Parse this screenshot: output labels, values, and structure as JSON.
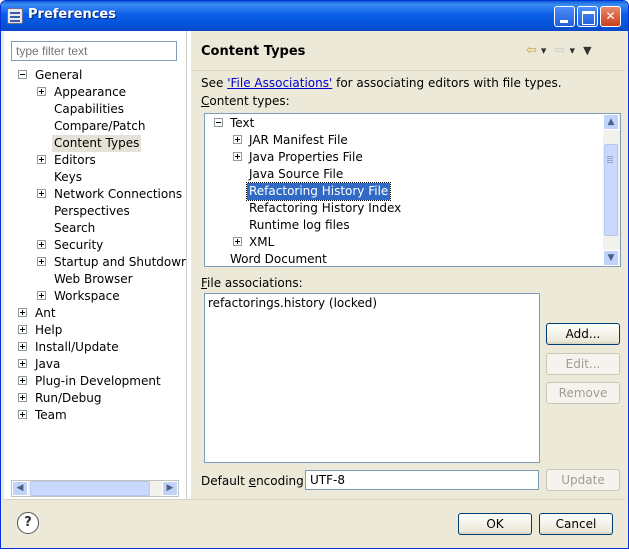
{
  "window": {
    "title": "Preferences"
  },
  "filter": {
    "placeholder": "type filter text"
  },
  "nav_tree": [
    {
      "label": "General",
      "expander": "minus"
    },
    {
      "label": "Appearance",
      "expander": "plus"
    },
    {
      "label": "Capabilities",
      "expander": ""
    },
    {
      "label": "Compare/Patch",
      "expander": ""
    },
    {
      "label": "Content Types",
      "expander": "",
      "selected": true
    },
    {
      "label": "Editors",
      "expander": "plus"
    },
    {
      "label": "Keys",
      "expander": ""
    },
    {
      "label": "Network Connections",
      "expander": "plus"
    },
    {
      "label": "Perspectives",
      "expander": ""
    },
    {
      "label": "Search",
      "expander": ""
    },
    {
      "label": "Security",
      "expander": "plus"
    },
    {
      "label": "Startup and Shutdowr",
      "expander": "plus"
    },
    {
      "label": "Web Browser",
      "expander": ""
    },
    {
      "label": "Workspace",
      "expander": "plus"
    },
    {
      "label": "Ant",
      "expander": "plus"
    },
    {
      "label": "Help",
      "expander": "plus"
    },
    {
      "label": "Install/Update",
      "expander": "plus"
    },
    {
      "label": "Java",
      "expander": "plus"
    },
    {
      "label": "Plug-in Development",
      "expander": "plus"
    },
    {
      "label": "Run/Debug",
      "expander": "plus"
    },
    {
      "label": "Team",
      "expander": "plus"
    }
  ],
  "page": {
    "title": "Content Types",
    "see_prefix": "See ",
    "see_link": "'File Associations'",
    "see_suffix": " for associating editors with file types.",
    "content_types_label_u": "C",
    "content_types_label_rest": "ontent types:",
    "file_assoc_label_u": "F",
    "file_assoc_label_rest": "ile associations:",
    "encoding_label_a": "Default ",
    "encoding_label_u": "e",
    "encoding_label_b": "ncoding:",
    "encoding_value": "UTF-8"
  },
  "content_types": [
    {
      "label": "Text",
      "expander": "minus"
    },
    {
      "label": "JAR Manifest File",
      "expander": "plus"
    },
    {
      "label": "Java Properties File",
      "expander": "plus"
    },
    {
      "label": "Java Source File",
      "expander": ""
    },
    {
      "label": "Refactoring History File",
      "expander": "",
      "selected": true
    },
    {
      "label": "Refactoring History Index",
      "expander": ""
    },
    {
      "label": "Runtime log files",
      "expander": ""
    },
    {
      "label": "XML",
      "expander": "plus"
    },
    {
      "label": "Word Document",
      "expander": ""
    }
  ],
  "file_associations": [
    "refactorings.history (locked)"
  ],
  "buttons": {
    "add": "Add...",
    "edit": "Edit...",
    "remove": "Remove",
    "update": "Update",
    "ok": "OK",
    "cancel": "Cancel"
  },
  "icons": {
    "back": "back-arrow-icon",
    "forward": "forward-arrow-icon",
    "menu": "view-menu-icon",
    "help": "help-icon"
  }
}
